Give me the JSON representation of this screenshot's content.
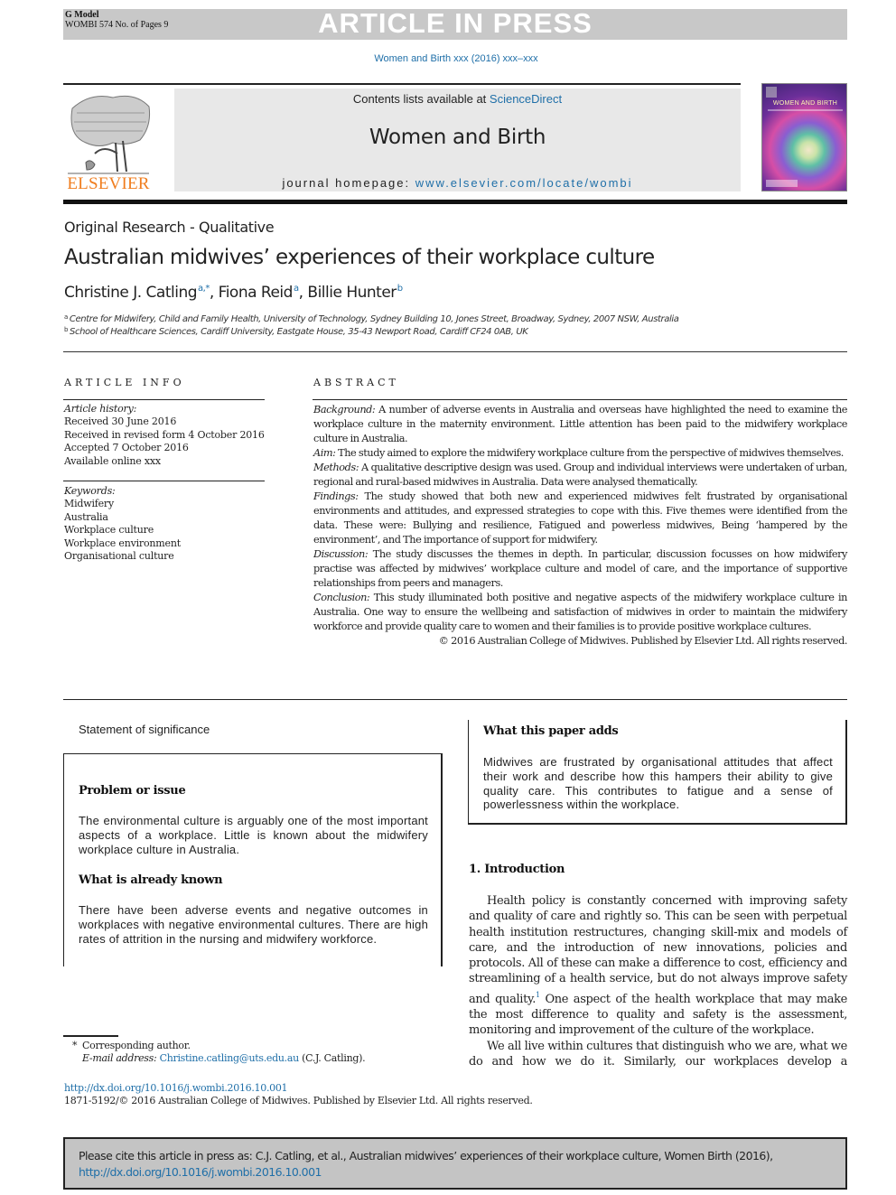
{
  "header": {
    "model_label": "G Model",
    "manuscript_info": "WOMBI 574 No. of Pages 9",
    "banner_text": "ARTICLE IN PRESS",
    "journal_ref": "Women and Birth xxx (2016) xxx–xxx"
  },
  "masthead": {
    "publisher_logo_text": "ELSEVIER",
    "contents_prefix": "Contents lists available at ",
    "contents_link": "ScienceDirect",
    "journal_title": "Women and Birth",
    "homepage_prefix": "journal homepage: ",
    "homepage_link": "www.elsevier.com/locate/wombi",
    "cover_title": "WOMEN AND BIRTH",
    "colors": {
      "publisher_orange": "#f07d1e",
      "link_blue": "#1f6fa8",
      "banner_gray": "#c8c8c8",
      "masthead_gray": "#e8e8e8"
    }
  },
  "article": {
    "type": "Original Research - Qualitative",
    "title": "Australian midwives’ experiences of their workplace culture",
    "authors": [
      {
        "name": "Christine J. Catling",
        "sup": "a,*"
      },
      {
        "name": "Fiona Reid",
        "sup": "a"
      },
      {
        "name": "Billie Hunter",
        "sup": "b"
      }
    ],
    "author_separator": ", ",
    "affiliations": [
      {
        "key": "a",
        "text": "Centre for Midwifery, Child and Family Health, University of Technology, Sydney Building 10, Jones Street, Broadway, Sydney, 2007 NSW, Australia"
      },
      {
        "key": "b",
        "text": "School of Healthcare Sciences, Cardiff University, Eastgate House, 35-43 Newport Road, Cardiff CF24 0AB, UK"
      }
    ]
  },
  "article_info": {
    "heading": "ARTICLE INFO",
    "history_label": "Article history:",
    "history": [
      "Received 30 June 2016",
      "Received in revised form 4 October 2016",
      "Accepted 7 October 2016",
      "Available online xxx"
    ],
    "keywords_label": "Keywords:",
    "keywords": [
      "Midwifery",
      "Australia",
      "Workplace culture",
      "Workplace environment",
      "Organisational culture"
    ]
  },
  "abstract": {
    "heading": "ABSTRACT",
    "sections": [
      {
        "label": "Background:",
        "text": " A number of adverse events in Australia and overseas have highlighted the need to examine the workplace culture in the maternity environment. Little attention has been paid to the midwifery workplace culture in Australia."
      },
      {
        "label": "Aim:",
        "text": " The study aimed to explore the midwifery workplace culture from the perspective of midwives themselves."
      },
      {
        "label": "Methods:",
        "text": " A qualitative descriptive design was used. Group and individual interviews were undertaken of urban, regional and rural-based midwives in Australia. Data were analysed thematically."
      },
      {
        "label": "Findings:",
        "text": " The study showed that both new and experienced midwives felt frustrated by organisational environments and attitudes, and expressed strategies to cope with this. Five themes were identified from the data. These were: Bullying and resilience, Fatigued and powerless midwives, Being ‘hampered by the environment’, and The importance of support for midwifery."
      },
      {
        "label": "Discussion:",
        "text": " The study discusses the themes in depth. In particular, discussion focusses on how midwifery practise was affected by midwives’ workplace culture and model of care, and the importance of supportive relationships from peers and managers."
      },
      {
        "label": "Conclusion:",
        "text": " This study illuminated both positive and negative aspects of the midwifery workplace culture in Australia. One way to ensure the wellbeing and satisfaction of midwives in order to maintain the midwifery workforce and provide quality care to women and their families is to provide positive workplace cultures."
      }
    ],
    "copyright": "© 2016 Australian College of Midwives. Published by Elsevier Ltd. All rights reserved."
  },
  "significance": {
    "label": "Statement of significance",
    "problem_heading": "Problem or issue",
    "problem_text": "The environmental culture is arguably one of the most important aspects of a workplace. Little is known about the midwifery workplace culture in Australia.",
    "known_heading": "What is already known",
    "known_text": "There have been adverse events and negative outcomes in workplaces with negative environmental cultures. There are high rates of attrition in the nursing and midwifery workforce.",
    "adds_heading": "What this paper adds",
    "adds_text": "Midwives are frustrated by organisational attitudes that affect their work and describe how this hampers their ability to give quality care. This contributes to fatigue and a sense of powerlessness within the workplace."
  },
  "introduction": {
    "heading": "1. Introduction",
    "p1_before_ref": "Health policy is constantly concerned with improving safety and quality of care and rightly so. This can be seen with perpetual health institution restructures, changing skill-mix and models of care, and the introduction of new innovations, policies and protocols. All of these can make a difference to cost, efficiency and streamlining of a health service, but do not always improve safety and quality.",
    "p1_ref": "1",
    "p1_after_ref": " One aspect of the health workplace that may make the most difference to quality and safety is the assessment, monitoring and improvement of the culture of the workplace.",
    "p2": "We all live within cultures that distinguish who we are, what we do and how we do it. Similarly, our workplaces develop a"
  },
  "footnotes": {
    "star": "*",
    "corresponding": "Corresponding author.",
    "email_label": "E-mail address:",
    "email": "Christine.catling@uts.edu.au",
    "email_suffix": " (C.J. Catling).",
    "doi": "http://dx.doi.org/10.1016/j.wombi.2016.10.001",
    "issn_line": "1871-5192/© 2016 Australian College of Midwives. Published by Elsevier Ltd. All rights reserved."
  },
  "citation": {
    "text": "Please cite this article in press as: C.J. Catling, et al., Australian midwives’ experiences of their workplace culture, Women Birth (2016), ",
    "link": "http://dx.doi.org/10.1016/j.wombi.2016.10.001"
  }
}
